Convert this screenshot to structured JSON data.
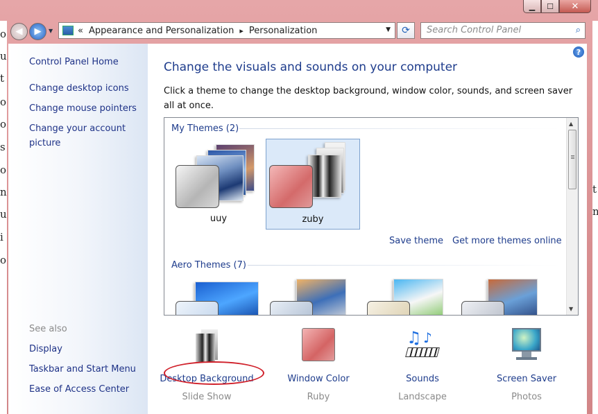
{
  "window": {
    "minimize": "▁",
    "maximize": "☐",
    "close": "✕"
  },
  "address": {
    "chevrons": "«",
    "crumb1": "Appearance and Personalization",
    "sep": "▸",
    "crumb2": "Personalization",
    "dropdown": "▼",
    "refresh": "⟳"
  },
  "search": {
    "placeholder": "Search Control Panel",
    "icon": "⌕"
  },
  "sidebar": {
    "links": [
      "Control Panel Home",
      "Change desktop icons",
      "Change mouse pointers",
      "Change your account",
      "picture"
    ],
    "see_also_label": "See also",
    "see_also": [
      "Display",
      "Taskbar and Start Menu",
      "Ease of Access Center"
    ]
  },
  "main": {
    "title": "Change the visuals and sounds on your computer",
    "description": "Click a theme to change the desktop background, window color, sounds, and screen saver all at once.",
    "help": "?"
  },
  "themes": {
    "my_themes_label": "My Themes (2)",
    "my_themes": [
      {
        "name": "uuy",
        "selected": false
      },
      {
        "name": "zuby",
        "selected": true
      }
    ],
    "save_theme": "Save theme",
    "get_more": "Get more themes online",
    "aero_label": "Aero Themes (7)"
  },
  "bottom": [
    {
      "label": "Desktop Background",
      "sub": "Slide Show"
    },
    {
      "label": "Window Color",
      "sub": "Ruby"
    },
    {
      "label": "Sounds",
      "sub": "Landscape"
    },
    {
      "label": "Screen Saver",
      "sub": "Photos"
    }
  ],
  "colors": {
    "link": "#1e3c8c",
    "frame": "#d98c8c",
    "annotation": "#d0202a"
  },
  "background_text": {
    "left": [
      "o",
      "u",
      "t",
      "o",
      "o",
      "s",
      "o",
      "n",
      "u",
      "i",
      "o"
    ],
    "right": [
      "t",
      "n"
    ]
  }
}
